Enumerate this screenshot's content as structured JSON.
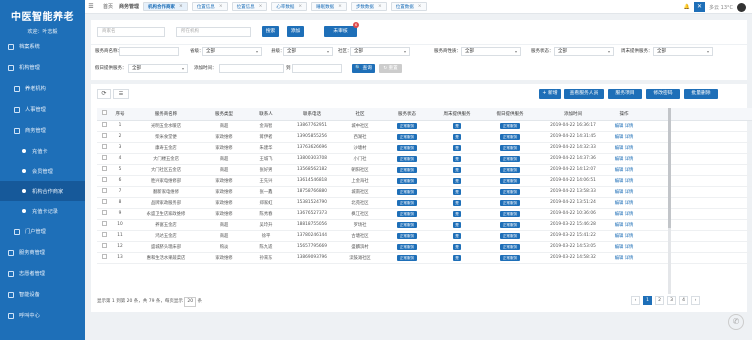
{
  "brand": {
    "title": "中医智能养老",
    "welcome": "欢迎：叶志毅"
  },
  "sidebar": [
    {
      "label": "档案系统",
      "level": 0
    },
    {
      "label": "机构管理",
      "level": 0
    },
    {
      "label": "养老机构",
      "level": 1
    },
    {
      "label": "人事管理",
      "level": 1
    },
    {
      "label": "商务管理",
      "level": 1
    },
    {
      "label": "充值卡",
      "level": 2
    },
    {
      "label": "会员管理",
      "level": 2
    },
    {
      "label": "机构合作商家",
      "level": 2,
      "active": true
    },
    {
      "label": "充值卡记录",
      "level": 2
    },
    {
      "label": "门户管理",
      "level": 1
    },
    {
      "label": "服务商管理",
      "level": 0
    },
    {
      "label": "志愿者管理",
      "level": 0
    },
    {
      "label": "智能设备",
      "level": 0
    },
    {
      "label": "呼叫中心",
      "level": 0
    }
  ],
  "topbar": {
    "menu_icon": "menu-icon",
    "home": "首页",
    "section": "商务管理",
    "tabs": [
      {
        "label": "机构合作商家",
        "active": true
      },
      {
        "label": "位置信息"
      },
      {
        "label": "位置信息"
      },
      {
        "label": "心率数据"
      },
      {
        "label": "睡眠数据"
      },
      {
        "label": "步数数据"
      },
      {
        "label": "位置数据"
      }
    ],
    "weather": "多云 13°C"
  },
  "filter1": {
    "name_placeholder": "商家名",
    "type_placeholder": "所在机构",
    "search": "搜索",
    "add": "添加",
    "unreviewed": "未审核",
    "unreviewed_count": "6"
  },
  "filter2": {
    "service_name_label": "服务商名称：",
    "province_label": "省级：",
    "province": "全部",
    "city_label": "县级：",
    "city": "全部",
    "district_label": "社区：",
    "district": "全部",
    "nature_label": "服务商性质：",
    "nature": "全部",
    "status_label": "服务状态：",
    "status": "全部",
    "weekly_label": "周末提供服务：",
    "weekly": "全部",
    "holiday_label": "假日提供服务：",
    "holiday": "全部",
    "add_time_label": "添加时间：",
    "to": "到",
    "query": "查询",
    "reset": "重置"
  },
  "toolbar": {
    "refresh": "⟳",
    "export": "☰",
    "add": "+ 新增",
    "assign": "查看服务人员",
    "service": "服务项目",
    "edit": "修改密码",
    "delete": "批量删除"
  },
  "columns": [
    "序号",
    "服务商名称",
    "服务类型",
    "联系人",
    "联系电话",
    "社区",
    "服务状态",
    "周末提供服务",
    "假日提供服务",
    "添加时间",
    "操作"
  ],
  "rows": [
    [
      "1",
      "光明五金水暖店",
      "商超",
      "金海智",
      "13867762951",
      "城中社区",
      "正常服务",
      "是",
      "正常服务",
      "2019-04-22 16:36:17"
    ],
    [
      "2",
      "柴米食堂便",
      "家政维修",
      "蒋伊者",
      "13905855256",
      "西湖社",
      "正常服务",
      "是",
      "正常服务",
      "2019-04-22 14:31:45"
    ],
    [
      "3",
      "康寿五金店",
      "家政维修",
      "朱建华",
      "13763626696",
      "沙塘村",
      "正常服务",
      "是",
      "正常服务",
      "2019-04-22 14:32:33"
    ],
    [
      "4",
      "大门楼五金店",
      "商超",
      "王城飞",
      "13800303708",
      "小门社",
      "正常服务",
      "是",
      "正常服务",
      "2019-04-22 14:37:36"
    ],
    [
      "5",
      "大门社区五金店",
      "商超",
      "张好男",
      "13568562182",
      "朝阳社区",
      "正常服务",
      "是",
      "正常服务",
      "2019-04-22 14:12:07"
    ],
    [
      "6",
      "胜兴家电维修部",
      "家政维修",
      "王先兴",
      "13614546818",
      "上金海社",
      "正常服务",
      "是",
      "正常服务",
      "2019-04-22 14:06:51"
    ],
    [
      "7",
      "翻新家电维修",
      "家政维修",
      "张一鑫",
      "18758766880",
      "城南社区",
      "正常服务",
      "是",
      "正常服务",
      "2019-04-22 13:58:33"
    ],
    [
      "8",
      "品牌家政服务部",
      "家政维修",
      "郑家虹",
      "15381524790",
      "北苑社区",
      "正常服务",
      "是",
      "正常服务",
      "2019-04-22 13:51:24"
    ],
    [
      "9",
      "永盛卫生店家政维修",
      "家政维修",
      "陈秀春",
      "13676527373",
      "枫江社区",
      "正常服务",
      "是",
      "正常服务",
      "2019-04-22 10:36:06"
    ],
    [
      "10",
      "养富五金店",
      "商超",
      "吴玲升",
      "18818755056",
      "罗场社",
      "正常服务",
      "是",
      "正常服务",
      "2019-03-22 15:46:28"
    ],
    [
      "11",
      "鸿达五金店",
      "商超",
      "徐平",
      "13780246144",
      "古塘社区",
      "正常服务",
      "是",
      "正常服务",
      "2019-03-22 15:41:22"
    ],
    [
      "12",
      "盛城脐头理床部",
      "购淡",
      "陈九适",
      "15657795669",
      "盛麟滨村",
      "正常服务",
      "是",
      "正常服务",
      "2019-03-22 14:53:05"
    ],
    [
      "13",
      "惠和生活水果蔬菜店",
      "家政维修",
      "孙来东",
      "13869093796",
      "渎鼓滩社区",
      "正常服务",
      "是",
      "正常服务",
      "2019-03-22 14:58:32"
    ]
  ],
  "row_ops": {
    "edit": "编辑",
    "detail": "详情"
  },
  "footer": {
    "summary": "显示第 1 到第 20 条，共 79 条，每页显示",
    "page_size": "20",
    "unit": "条",
    "pages": [
      "‹",
      "1",
      "2",
      "3",
      "4",
      "›"
    ],
    "current": "1"
  }
}
